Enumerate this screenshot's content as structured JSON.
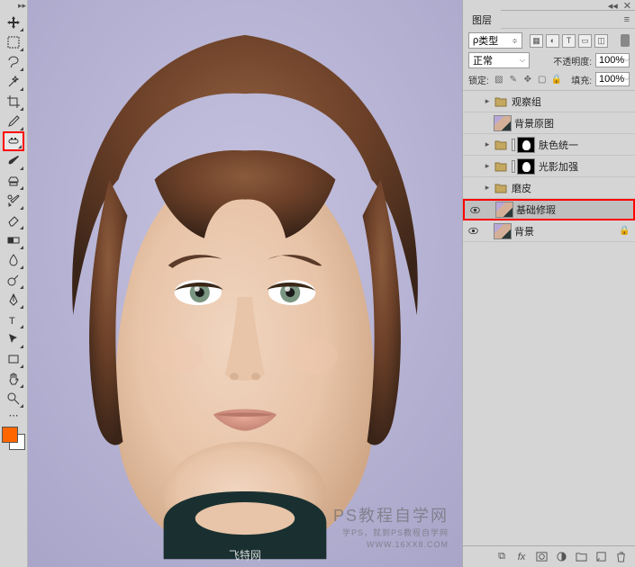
{
  "toolbar": {
    "tools": [
      "move",
      "rect-marquee",
      "lasso",
      "magic-wand",
      "crop",
      "eyedropper",
      "spot-heal",
      "brush",
      "clone",
      "history-brush",
      "eraser",
      "gradient",
      "blur",
      "dodge",
      "pen",
      "type",
      "path-select",
      "rectangle",
      "hand",
      "zoom"
    ],
    "selected_index": 6,
    "fg_color": "#ff6600",
    "bg_color": "#ffffff"
  },
  "canvas": {
    "watermark_center": "飞特网",
    "watermark_right_main": "PS教程自学网",
    "watermark_right_sub": "学PS，就到PS教程自学网",
    "watermark_right_url": "WWW.16XX8.COM"
  },
  "layers_panel": {
    "title": "图层",
    "kind_filter": "类型",
    "blend_mode": "正常",
    "opacity_label": "不透明度:",
    "opacity_value": "100%",
    "lock_label": "锁定:",
    "fill_label": "填充:",
    "fill_value": "100%",
    "layers": [
      {
        "type": "group",
        "visible": false,
        "collapsed": true,
        "name": "观察组",
        "mask": false
      },
      {
        "type": "layer",
        "visible": false,
        "name": "背景原图",
        "thumb": "face",
        "indent": 0
      },
      {
        "type": "group",
        "visible": false,
        "collapsed": true,
        "name": "肤色统一",
        "mask": true,
        "links": true
      },
      {
        "type": "group",
        "visible": false,
        "collapsed": true,
        "name": "光影加强",
        "mask": true,
        "links": true
      },
      {
        "type": "group",
        "visible": false,
        "collapsed": true,
        "name": "磨皮",
        "mask": false
      },
      {
        "type": "layer",
        "visible": true,
        "name": "基础修瑕",
        "thumb": "face",
        "selected": true,
        "indent": 0
      },
      {
        "type": "layer",
        "visible": true,
        "name": "背景",
        "thumb": "face",
        "locked": true,
        "indent": 0
      }
    ]
  }
}
